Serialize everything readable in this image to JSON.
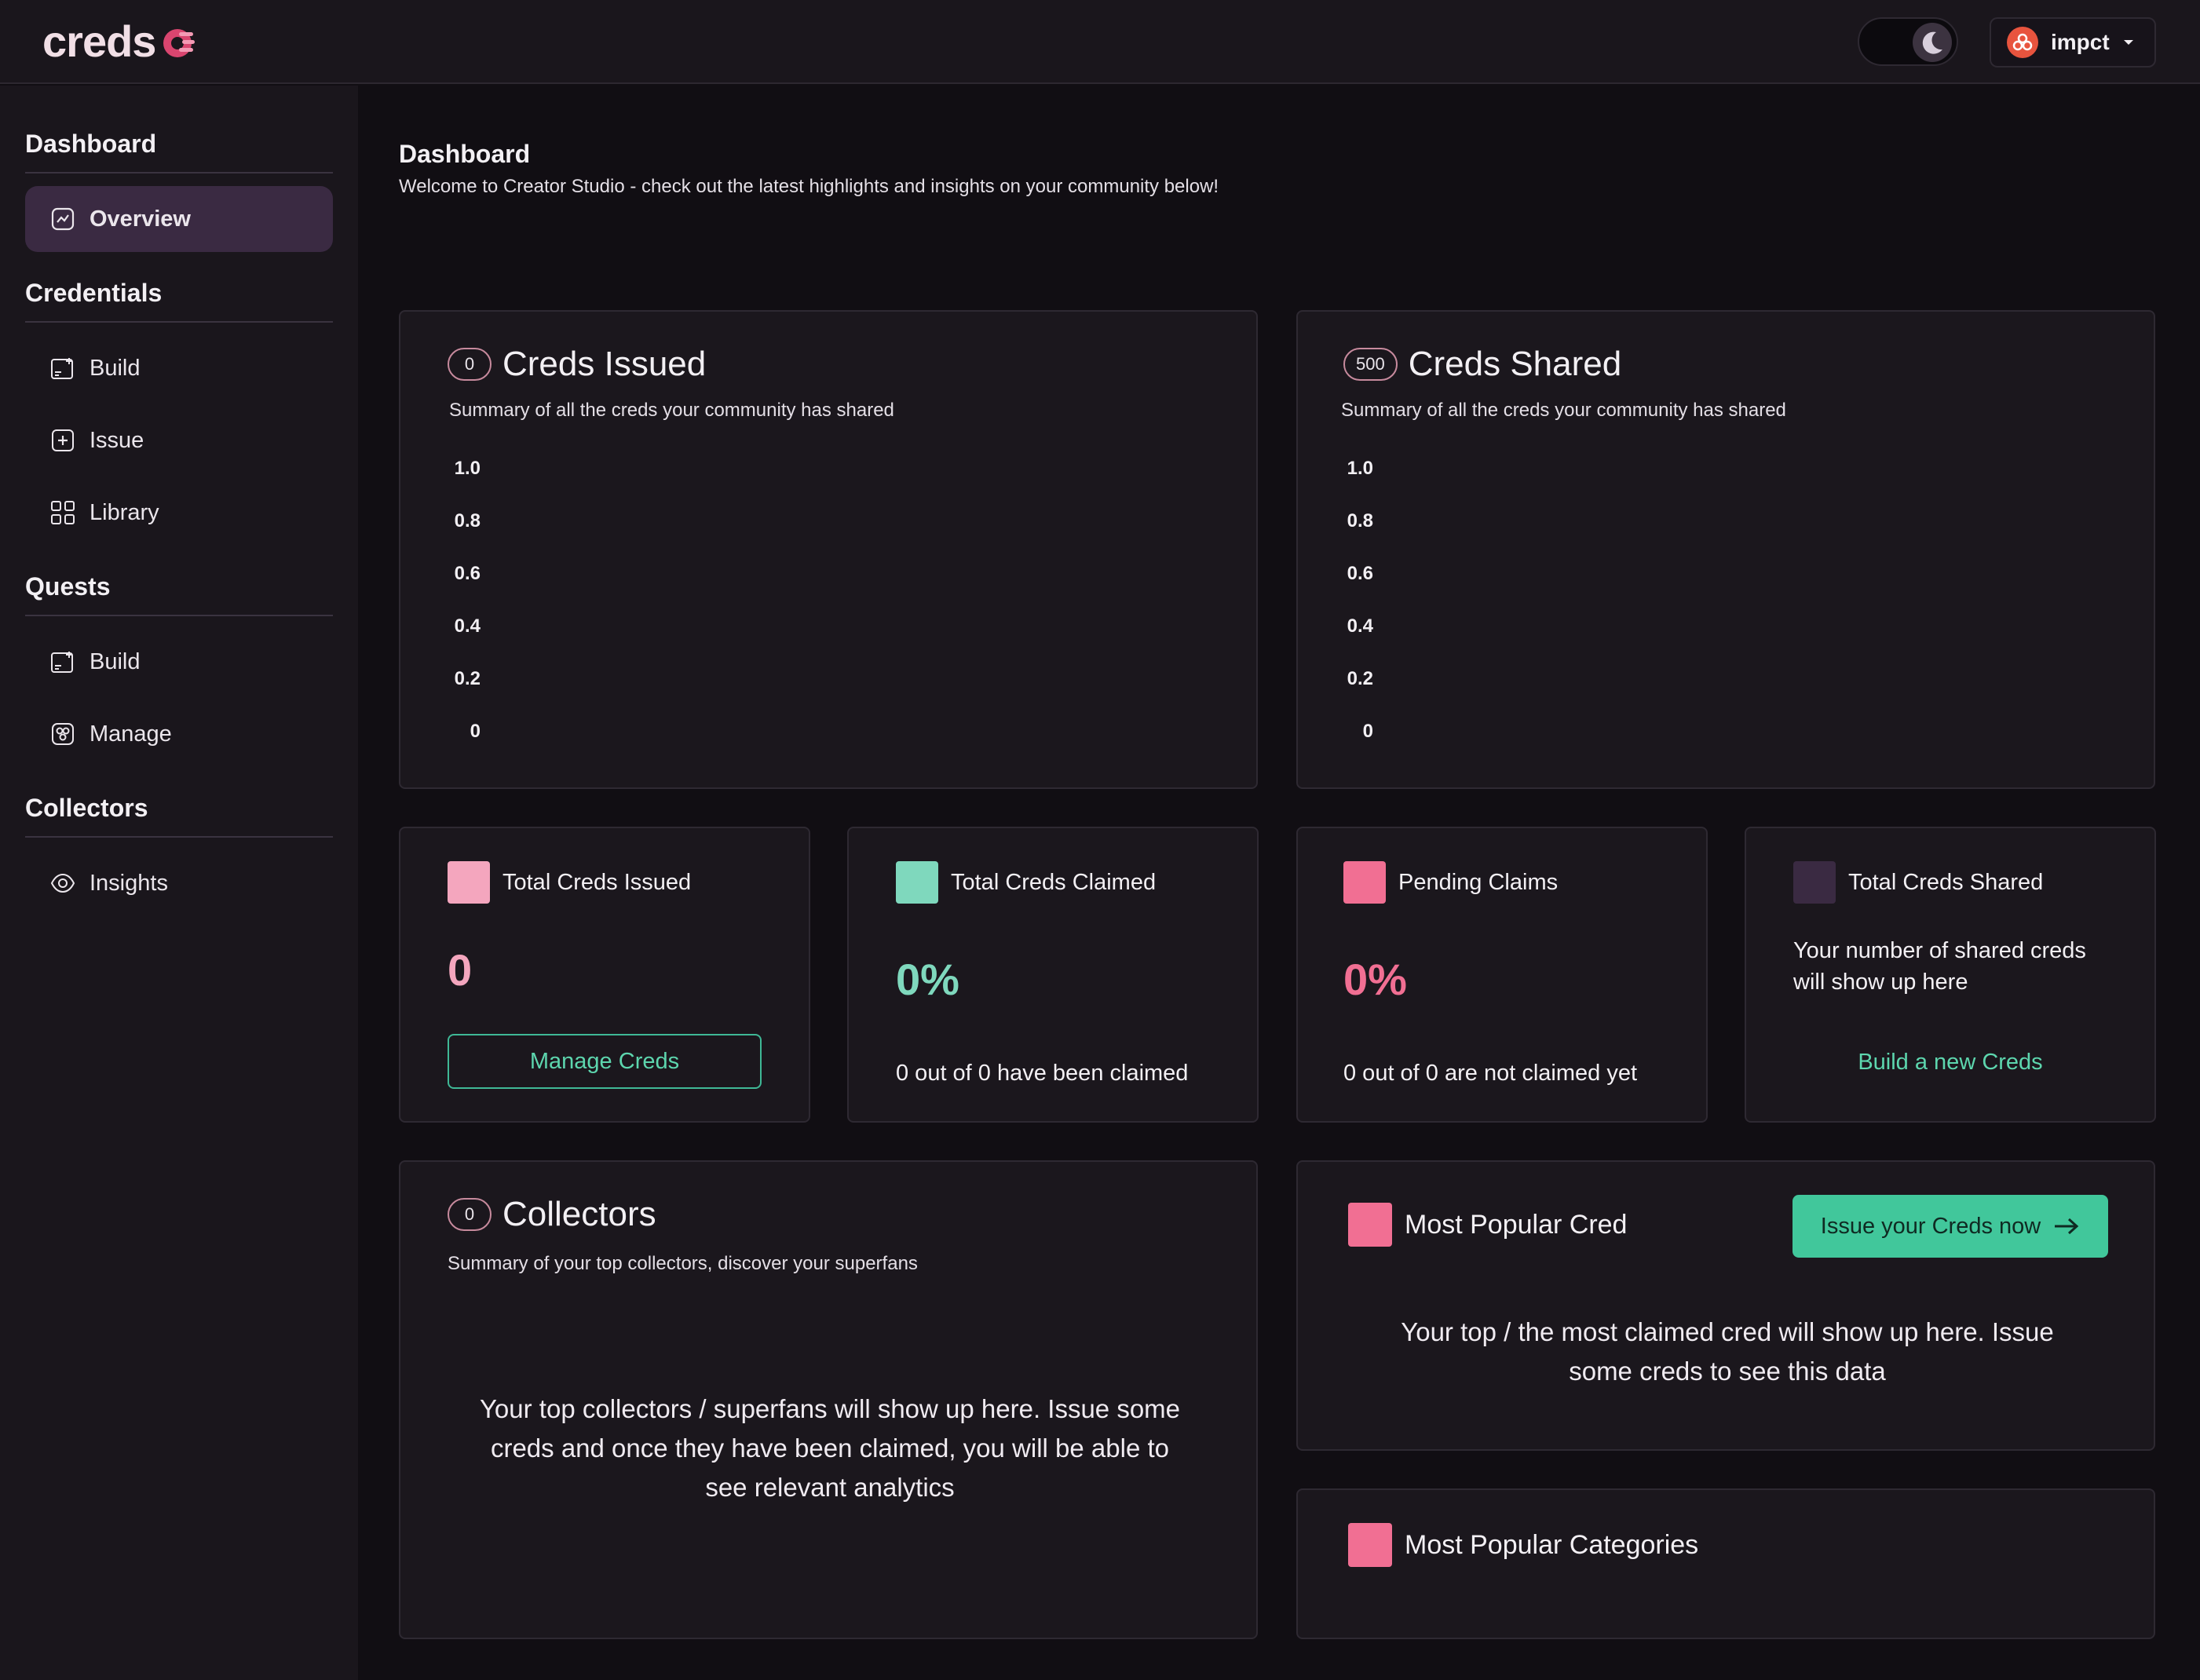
{
  "app": {
    "logo_text": "creds"
  },
  "header": {
    "user_name": "impct",
    "theme_mode_icon": "moon-icon"
  },
  "sidebar": {
    "sections": [
      {
        "title": "Dashboard",
        "items": [
          {
            "label": "Overview",
            "icon": "chart-icon",
            "active": true
          }
        ]
      },
      {
        "title": "Credentials",
        "items": [
          {
            "label": "Build",
            "icon": "build-icon"
          },
          {
            "label": "Issue",
            "icon": "plus-square-icon"
          },
          {
            "label": "Library",
            "icon": "grid-icon"
          }
        ]
      },
      {
        "title": "Quests",
        "items": [
          {
            "label": "Build",
            "icon": "build-icon"
          },
          {
            "label": "Manage",
            "icon": "manage-icon"
          }
        ]
      },
      {
        "title": "Collectors",
        "items": [
          {
            "label": "Insights",
            "icon": "eye-icon"
          }
        ]
      }
    ]
  },
  "page": {
    "title": "Dashboard",
    "subtitle": "Welcome to Creator Studio - check out the latest highlights and insights on your community below!"
  },
  "creds_issued": {
    "count": "0",
    "title": "Creds Issued",
    "subtitle": "Summary of all the creds your community has shared"
  },
  "creds_shared": {
    "count": "500",
    "title": "Creds Shared",
    "subtitle": "Summary of all the creds your community has shared"
  },
  "chart_data": [
    {
      "type": "bar",
      "title": "Creds Issued",
      "categories": [],
      "values": [],
      "yticks": [
        "1.0",
        "0.8",
        "0.6",
        "0.4",
        "0.2",
        "0"
      ],
      "ylim": [
        0,
        1
      ]
    },
    {
      "type": "bar",
      "title": "Creds Shared",
      "categories": [],
      "values": [],
      "yticks": [
        "1.0",
        "0.8",
        "0.6",
        "0.4",
        "0.2",
        "0"
      ],
      "ylim": [
        0,
        1
      ]
    }
  ],
  "stats": {
    "total_issued": {
      "label": "Total Creds Issued",
      "value": "0",
      "button": "Manage Creds",
      "color": "#f4a6be"
    },
    "total_claimed": {
      "label": "Total Creds Claimed",
      "value": "0%",
      "footer": "0 out of 0 have been claimed",
      "color": "#7fd8bd"
    },
    "pending_claims": {
      "label": "Pending Claims",
      "value": "0%",
      "footer": "0 out of 0 are not claimed yet",
      "color": "#f16f93"
    },
    "total_shared": {
      "label": "Total Creds Shared",
      "line1": "Your number of shared creds",
      "line2": "will show up here",
      "link": "Build a new Creds",
      "color": "#3a2a42"
    }
  },
  "collectors": {
    "count": "0",
    "title": "Collectors",
    "subtitle": "Summary of your top collectors, discover your superfans",
    "empty_line1": "Your top collectors / superfans will show up here. Issue some",
    "empty_line2": "creds and once they have been claimed, you will be able to",
    "empty_line3": "see relevant analytics"
  },
  "popular_cred": {
    "title": "Most Popular Cred",
    "button": "Issue your Creds now",
    "empty_line1": "Your top / the most claimed cred will show up here. Issue",
    "empty_line2": "some creds to see this data",
    "color": "#f16f93"
  },
  "popular_categories": {
    "title": "Most Popular Categories",
    "color": "#f16f93"
  }
}
